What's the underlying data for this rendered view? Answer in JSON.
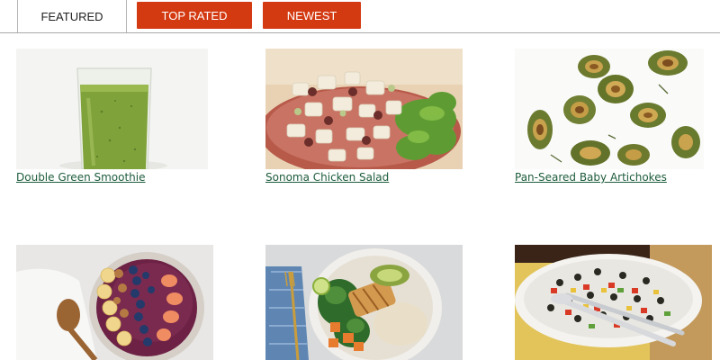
{
  "tabs": [
    {
      "label": "FEATURED",
      "active": true
    },
    {
      "label": "TOP RATED",
      "active": false
    },
    {
      "label": "NEWEST",
      "active": false
    }
  ],
  "colors": {
    "accent": "#d33a12",
    "link": "#1d5c3c"
  },
  "recipes": [
    {
      "title": "Double Green Smoothie",
      "image": "green-smoothie-image"
    },
    {
      "title": "Sonoma Chicken Salad",
      "image": "chicken-salad-image"
    },
    {
      "title": "Pan-Seared Baby Artichokes",
      "image": "artichokes-image"
    },
    {
      "title": "",
      "image": "acai-bowl-image"
    },
    {
      "title": "",
      "image": "chicken-grain-bowl-image"
    },
    {
      "title": "",
      "image": "black-bean-salad-image"
    }
  ]
}
